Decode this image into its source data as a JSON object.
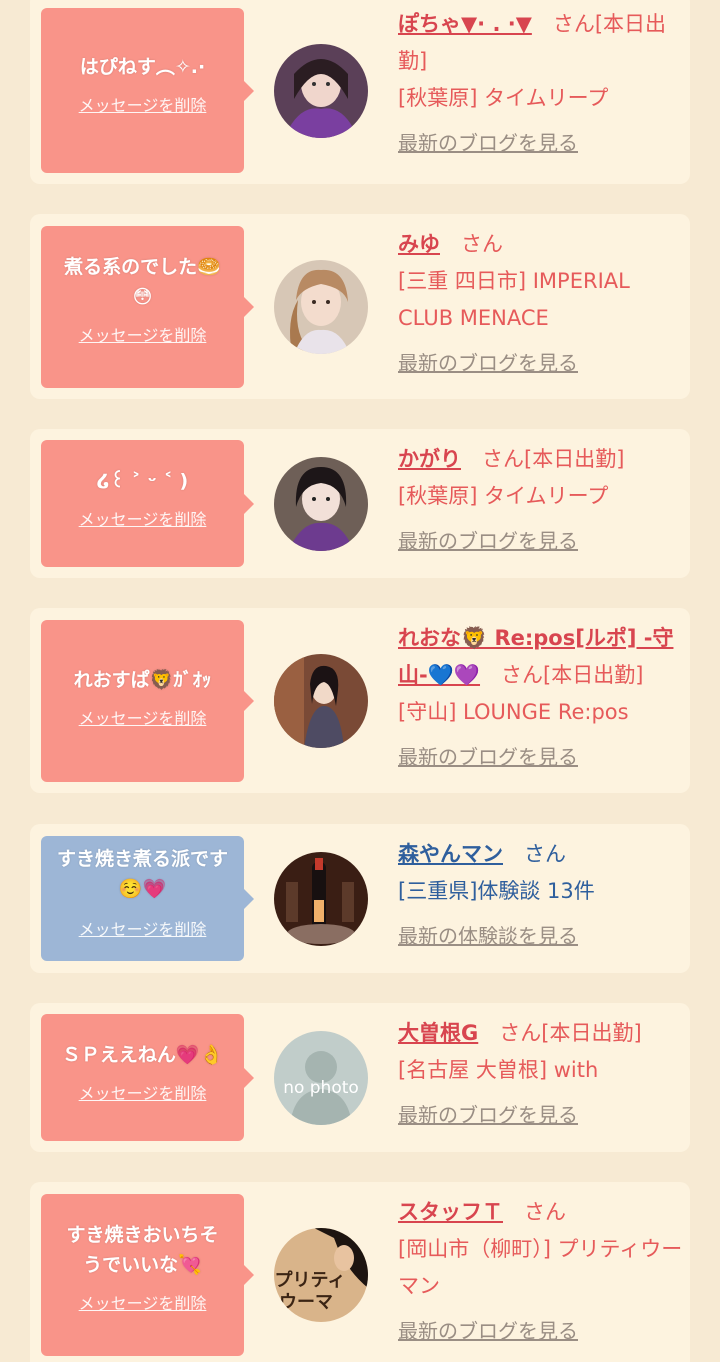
{
  "delete_label": "メッセージを削除",
  "san_label": "さん",
  "entries": [
    {
      "message": "はぴねす︵✧.·",
      "name": "ぽちゃ▼· . ·▼",
      "suffix": "[本日出勤]",
      "location": "[秋葉原] タイムリープ",
      "blog": "最新のブログを見る"
    },
    {
      "message": "煮る系のでした🥯😳",
      "name": "みゆ",
      "suffix": "",
      "location": "[三重 四日市] IMPERIAL CLUB MENACE",
      "blog": "最新のブログを見る"
    },
    {
      "message": "໒꒰ ˃ ᵕ ˂ )",
      "name": "かがり",
      "suffix": "[本日出勤]",
      "location": "[秋葉原] タイムリープ",
      "blog": "最新のブログを見る"
    },
    {
      "message": "れおすぱ🦁ｶﾞｵｯ",
      "name": "れおな🦁 Re:pos[ルポ] -守山-💙💜",
      "suffix": "[本日出勤]",
      "location": "[守山] LOUNGE Re:pos",
      "blog": "最新のブログを見る"
    },
    {
      "message": "すき焼き煮る派です☺️💗",
      "name": "森やんマン",
      "suffix": "",
      "location": "[三重県]体験談 13件",
      "blog": "最新の体験談を見る"
    },
    {
      "message": "ＳＰええねん💗👌",
      "name": "大曽根G",
      "suffix": "[本日出勤]",
      "location": "[名古屋 大曽根] with",
      "blog": "最新のブログを見る"
    },
    {
      "message": "すき焼きおいちそうでいいな💘",
      "name": "スタッフＴ",
      "suffix": "",
      "location": "[岡山市（柳町）] プリティウーマン",
      "blog": "最新のブログを見る"
    }
  ],
  "nophoto_text": "no photo",
  "colors": {
    "background": "#f7ead3",
    "card": "#fdf3df",
    "bubble_pink": "#f99489",
    "bubble_blue": "#9db6d6",
    "name_red": "#d8454f",
    "name_blue": "#2f5f9d",
    "link_gray": "#9a8e84"
  }
}
